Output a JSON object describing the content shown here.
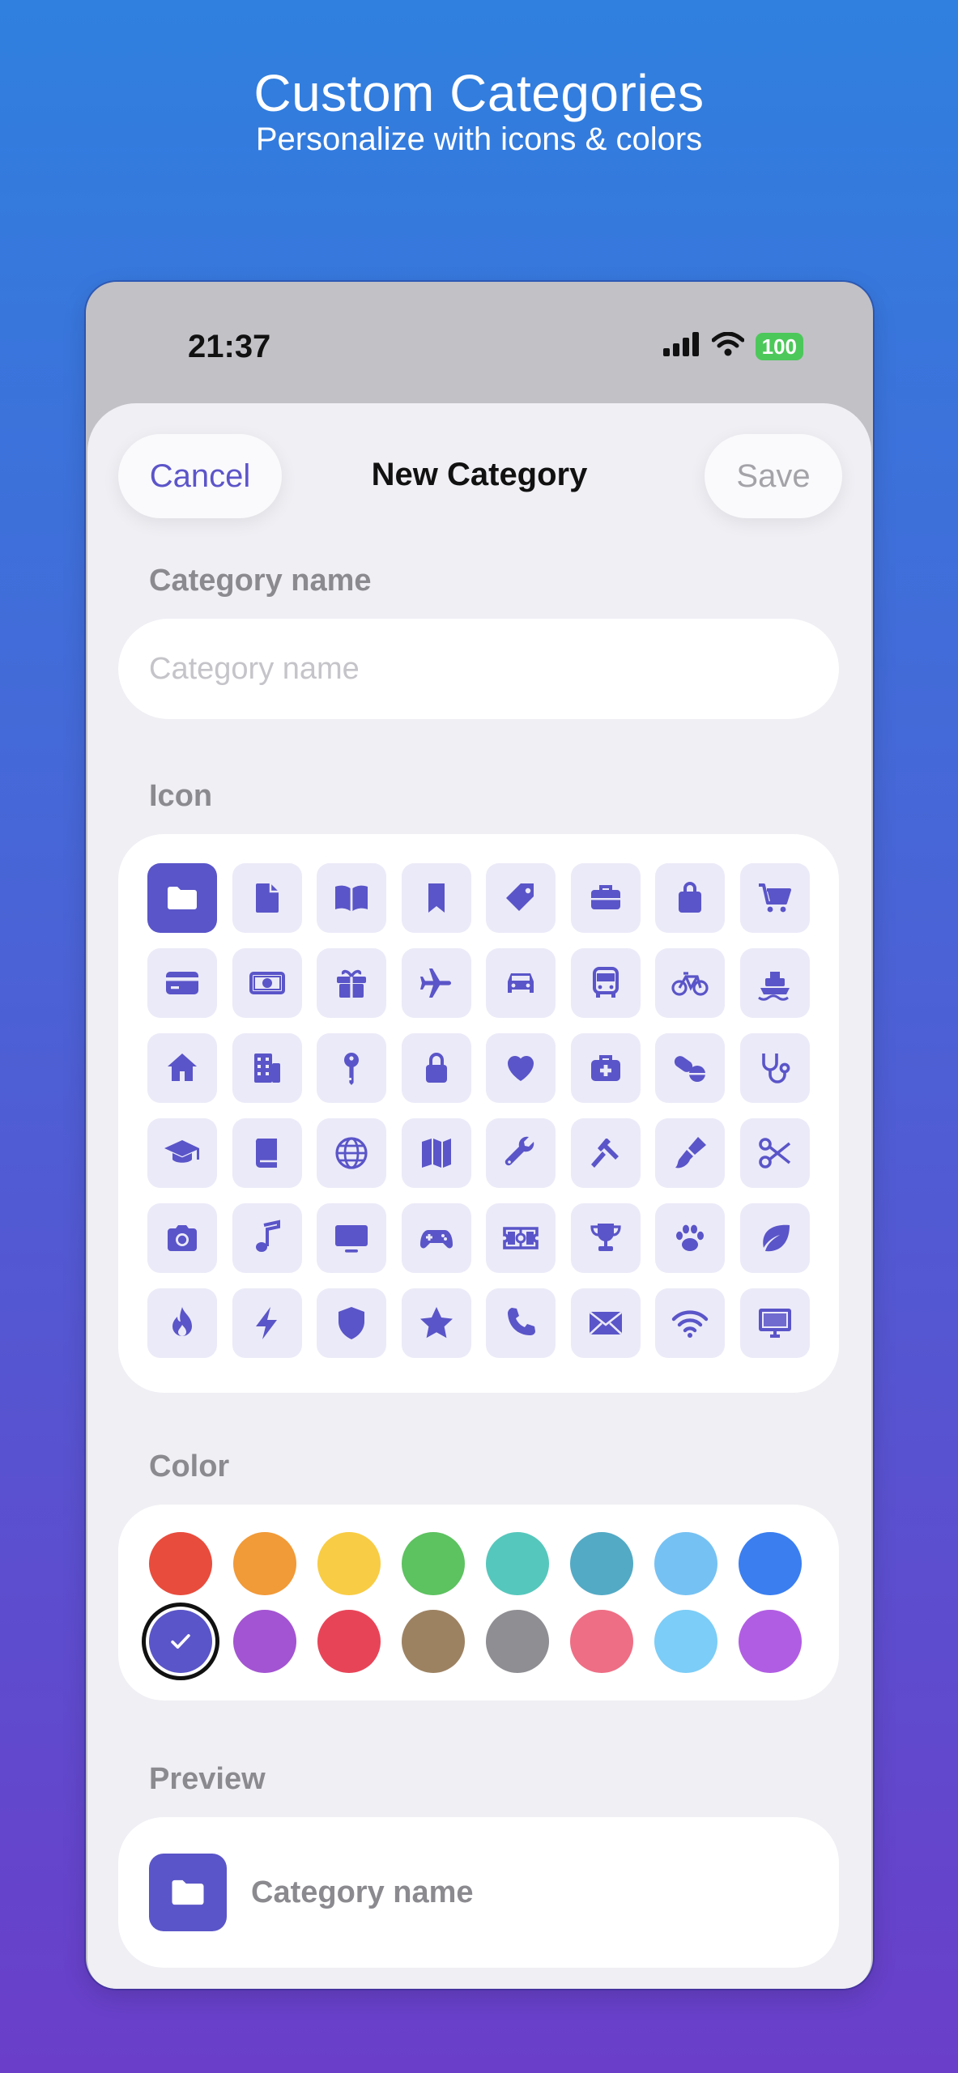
{
  "promo": {
    "title": "Custom Categories",
    "subtitle": "Personalize with icons & colors"
  },
  "status_bar": {
    "time": "21:37",
    "battery": "100",
    "icons": [
      "cellular-signal-icon",
      "wifi-icon",
      "battery-icon"
    ]
  },
  "nav": {
    "cancel_label": "Cancel",
    "title": "New Category",
    "save_label": "Save"
  },
  "name_section": {
    "label": "Category name",
    "placeholder": "Category name",
    "value": ""
  },
  "icon_section": {
    "label": "Icon",
    "selected_index": 0,
    "icons": [
      "folder",
      "doc",
      "book-open",
      "bookmark",
      "tag",
      "briefcase",
      "shopping-bag",
      "cart",
      "credit-card",
      "banknote",
      "gift",
      "airplane",
      "car",
      "bus",
      "bicycle",
      "ferry",
      "house",
      "building",
      "key",
      "lock",
      "heart",
      "medical-bag",
      "pills",
      "stethoscope",
      "graduation-cap",
      "book",
      "globe",
      "map",
      "wrench",
      "hammer",
      "paintbrush",
      "scissors",
      "camera",
      "music-note",
      "tv",
      "gamecontroller",
      "ticket",
      "trophy",
      "pawprint",
      "leaf",
      "flame",
      "bolt",
      "shield",
      "star",
      "phone",
      "envelope",
      "wifi",
      "desktop"
    ]
  },
  "color_section": {
    "label": "Color",
    "selected_index": 8,
    "colors": [
      "#e84c3d",
      "#f19a38",
      "#f8cc44",
      "#5dc260",
      "#56c7bc",
      "#53aac5",
      "#76c1f3",
      "#3a7ef0",
      "#5a55c8",
      "#a354d2",
      "#e84458",
      "#9d8262",
      "#8e8e93",
      "#ee6e85",
      "#7ccdf7",
      "#b15de3"
    ]
  },
  "preview": {
    "label": "Preview",
    "name": "Category name",
    "icon": "folder",
    "color": "#5a55c8"
  },
  "accent_color": "#5a55c8"
}
